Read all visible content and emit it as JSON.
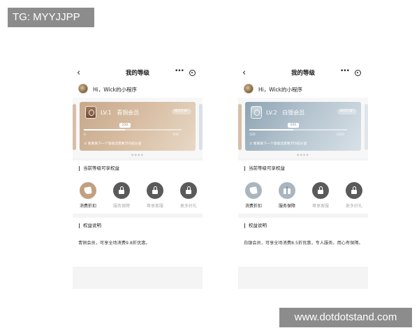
{
  "watermark_top_left": "TG: MYYJJPP",
  "watermark_bottom_right": "www.dotdotstand.com",
  "screens": [
    {
      "nav": {
        "back_icon": "chevron-left-icon",
        "title": "我的等级",
        "more_icon": "more-dots-icon",
        "target_icon": "target-icon"
      },
      "user": {
        "greeting": "Hi，Wick的小程序"
      },
      "card": {
        "theme": "bronze",
        "level": "LV.1",
        "level_name": "青铜会员",
        "how_to_upgrade": "如何升级?",
        "current_value": "250",
        "progress": 0.42,
        "scale_min": "0",
        "scale_max": "500",
        "upgrade_message": "① 距离离下一个等级还需要350成长值",
        "colors": {
          "peek_left": "#d6bfa6",
          "peek_right": "#d9e0e6"
        }
      },
      "benefits": {
        "title": "当前等级可享权益",
        "items": [
          {
            "label": "消费折扣",
            "active": true,
            "icon": "discount-tag-icon",
            "color": "#c2a07f"
          },
          {
            "label": "服务保障",
            "active": false,
            "icon": "lock-icon",
            "color": "#5a5a5a"
          },
          {
            "label": "尊享客服",
            "active": false,
            "icon": "lock-icon",
            "color": "#5a5a5a"
          },
          {
            "label": "更多好礼",
            "active": false,
            "icon": "lock-icon",
            "color": "#5a5a5a"
          }
        ]
      },
      "description": {
        "title": "权益说明",
        "text": "青铜会员，可享全场消费9.8折优惠。"
      }
    },
    {
      "nav": {
        "back_icon": "chevron-left-icon",
        "title": "我的等级",
        "more_icon": "more-dots-icon",
        "target_icon": "target-icon"
      },
      "user": {
        "greeting": "Hi，Wick的小程序"
      },
      "card": {
        "theme": "silver",
        "level": "LV.2",
        "level_name": "白银会员",
        "how_to_upgrade": "如何升级?",
        "current_value": "650",
        "progress": 0.45,
        "scale_min": "500",
        "scale_max": "1000",
        "upgrade_message": "① 距离离下一个等级还需要350成长值",
        "colors": {
          "peek_left": "#d6bfa6",
          "peek_right": "#dfe5ea"
        }
      },
      "benefits": {
        "title": "当前等级可享权益",
        "items": [
          {
            "label": "消费折扣",
            "active": true,
            "icon": "discount-tag-icon",
            "color": "#a9b6c0"
          },
          {
            "label": "服务保障",
            "active": true,
            "icon": "gift-box-icon",
            "color": "#a9b6c0"
          },
          {
            "label": "尊享客服",
            "active": false,
            "icon": "lock-icon",
            "color": "#5a5a5a"
          },
          {
            "label": "更多好礼",
            "active": false,
            "icon": "lock-icon",
            "color": "#5a5a5a"
          }
        ]
      },
      "description": {
        "title": "权益说明",
        "text": "白银会员，可享全场消费8.5折优惠，专人服务，用心有保障。"
      }
    }
  ]
}
